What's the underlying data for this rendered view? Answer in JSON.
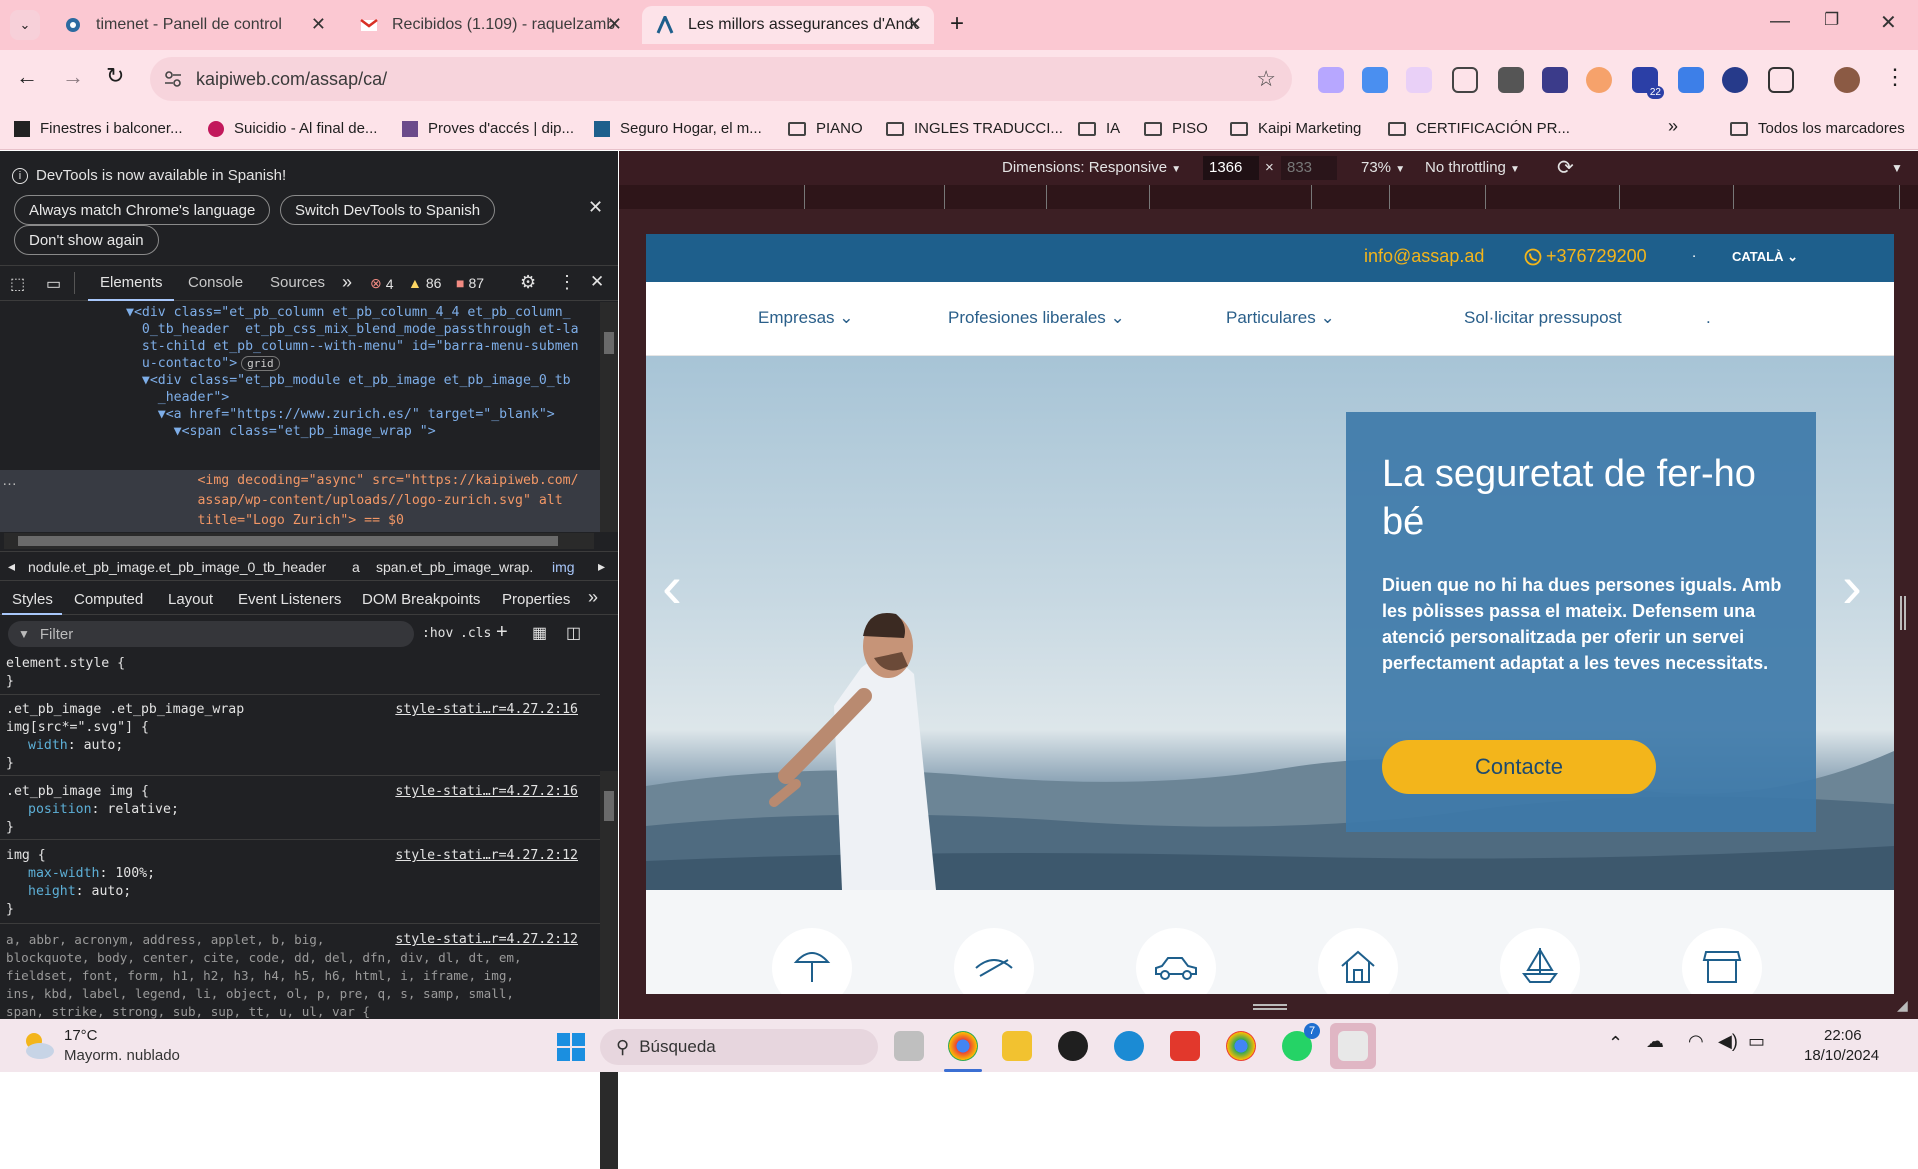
{
  "tabs": [
    {
      "title": "timenet - Panell de control",
      "active": false
    },
    {
      "title": "Recibidos (1.109) - raquelzamb",
      "active": false
    },
    {
      "title": "Les millors assegurances d'Andorra",
      "active": true
    }
  ],
  "new_tab": "+",
  "window_controls": {
    "minimize": "—",
    "restore": "❐",
    "close": "✕"
  },
  "address": {
    "url": "kaipiweb.com/assap/ca/"
  },
  "extension_badge": "22",
  "bookmarks": [
    {
      "label": "Finestres i balconer...",
      "icon": "page-icon"
    },
    {
      "label": "Suicidio - Al final de...",
      "icon": "page-icon"
    },
    {
      "label": "Proves d'accés | dip...",
      "icon": "page-icon"
    },
    {
      "label": "Seguro Hogar, el m...",
      "icon": "page-icon"
    },
    {
      "label": "PIANO",
      "icon": "folder-icon"
    },
    {
      "label": "INGLES TRADUCCI...",
      "icon": "folder-icon"
    },
    {
      "label": "IA",
      "icon": "folder-icon"
    },
    {
      "label": "PISO",
      "icon": "folder-icon"
    },
    {
      "label": "Kaipi Marketing",
      "icon": "folder-icon"
    },
    {
      "label": "CERTIFICACIÓN PR...",
      "icon": "folder-icon"
    }
  ],
  "bookmarks_more": "»",
  "all_bookmarks": "Todos los marcadores",
  "devtools": {
    "notice": "DevTools is now available in Spanish!",
    "btn_match": "Always match Chrome's language",
    "btn_switch": "Switch DevTools to Spanish",
    "btn_dont": "Don't show again",
    "tabs": [
      "Elements",
      "Console",
      "Sources"
    ],
    "errors": "4",
    "warnings": "86",
    "issues": "87",
    "dom_lines": [
      "▼<div class=\"et_pb_column et_pb_column_4_4 et_pb_column_",
      "  0_tb_header  et_pb_css_mix_blend_mode_passthrough et-la",
      "  st-child et_pb_column--with-menu\" id=\"barra-menu-submen",
      "  u-contacto\">",
      "  ▼<div class=\"et_pb_module et_pb_image et_pb_image_0_tb",
      "    _header\">",
      "    ▼<a href=\"https://www.zurich.es/\" target=\"_blank\">",
      "      ▼<span class=\"et_pb_image_wrap \">",
      "         <img decoding=\"async\" src=\"https://kaipiweb.com/",
      "         assap/wp-content/uploads//logo-zurich.svg\" alt",
      "         title=\"Logo Zurich\"> == $0"
    ],
    "grid_badge": "grid",
    "breadcrumb": [
      "nodule.et_pb_image.et_pb_image_0_tb_header",
      "a",
      "span.et_pb_image_wrap.",
      "img"
    ],
    "subtabs": [
      "Styles",
      "Computed",
      "Layout",
      "Event Listeners",
      "DOM Breakpoints",
      "Properties"
    ],
    "filter_placeholder": "Filter",
    "hov": ":hov",
    "cls": ".cls",
    "rules": [
      {
        "selector": "element.style {",
        "props": [],
        "source": ""
      },
      {
        "selector": ".et_pb_image .et_pb_image_wrap\nimg[src*=\".svg\"] {",
        "props": [
          [
            "width",
            "auto;"
          ]
        ],
        "source": "style-stati…r=4.27.2:16"
      },
      {
        "selector": ".et_pb_image img {",
        "props": [
          [
            "position",
            "relative;"
          ]
        ],
        "source": "style-stati…r=4.27.2:16"
      },
      {
        "selector": "img {",
        "props": [
          [
            "max-width",
            "100%;"
          ],
          [
            "height",
            "auto;"
          ]
        ],
        "source": "style-stati…r=4.27.2:12"
      }
    ],
    "reset_source": "style-stati…r=4.27.2:12",
    "reset_text": "a, abbr, acronym, address, applet, b, big,\nblockquote, body, center, cite, code, dd, del, dfn, div, dl, dt, em,\nfieldset, font, form, h1, h2, h3, h4, h5, h6, html, i, iframe, img,\nins, kbd, label, legend, li, object, ol, p, pre, q, s, samp, small,\nspan, strike, strong, sub, sup, tt, u, ul, var {"
  },
  "device_toolbar": {
    "dimensions": "Dimensions: Responsive",
    "width": "1366",
    "x": "×",
    "height": "833",
    "zoom": "73%",
    "throttle": "No throttling"
  },
  "site": {
    "email": "info@assap.ad",
    "phone": "+376729200",
    "dot": ".",
    "lang": "CATALÀ",
    "nav": [
      "Empresas",
      "Profesiones liberales",
      "Particulares"
    ],
    "quote": "Sol·licitar pressupost",
    "nav_dot": ".",
    "hero_title": "La seguretat de fer-ho bé",
    "hero_text": "Diuen que no hi ha dues persones iguals. Amb les pòlisses passa el mateix. Defensem una atenció personalitzada per oferir un servei perfectament adaptat a les teves necessitats.",
    "cta": "Contacte",
    "icons": [
      "umbrella-family-icon",
      "hand-protection-icon",
      "car-icon",
      "house-icon",
      "boat-icon",
      "store-icon"
    ],
    "colors": {
      "topbar": "#1e5f8c",
      "accent": "#f3b51b",
      "panel": "#3e7aa9"
    }
  },
  "taskbar": {
    "temp": "17°C",
    "weather": "Mayorm. nublado",
    "search": "Búsqueda",
    "time": "22:06",
    "date": "18/10/2024",
    "whatsapp_badge": "7"
  }
}
